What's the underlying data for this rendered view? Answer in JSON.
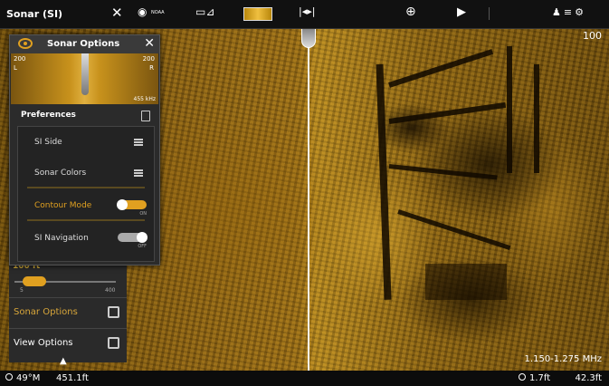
{
  "top_bar": {
    "title": "Sonar (SI)",
    "noaa_label": "NOAA",
    "icons": [
      "close-icon",
      "compass-icon",
      "chart-icon",
      "sonar-view-icon",
      "side-imaging-icon",
      "target-icon",
      "play-icon",
      "status-icons"
    ]
  },
  "range_scale": "100",
  "options_panel": {
    "title": "Sonar Options",
    "preview": {
      "left_range": "200",
      "left_side": "L",
      "right_range": "200",
      "right_side": "R",
      "frequency": "455 kHz"
    },
    "preferences_label": "Preferences",
    "items": [
      {
        "label": "SI Side",
        "control": "menu"
      },
      {
        "label": "Sonar Colors",
        "control": "menu"
      },
      {
        "label": "Contour Mode",
        "control": "toggle",
        "state": "ON",
        "highlighted": true
      },
      {
        "label": "SI Navigation",
        "control": "toggle",
        "state": "OFF"
      }
    ]
  },
  "left_menu": {
    "depth_range_label": "100 ft",
    "slider_min": "5",
    "slider_max": "400",
    "items": [
      {
        "label": "Sonar Options",
        "active": true
      },
      {
        "label": "View Options",
        "active": false
      }
    ]
  },
  "frequency_readout": "1.150-1.275 MHz",
  "status_bar": {
    "water_temp": "49°M",
    "depth": "451.1ft",
    "speed": "1.7ft",
    "distance": "42.3ft"
  },
  "colors": {
    "accent": "#e0a020",
    "panel_bg": "#2b2b2b",
    "topbar_bg": "#111111"
  }
}
